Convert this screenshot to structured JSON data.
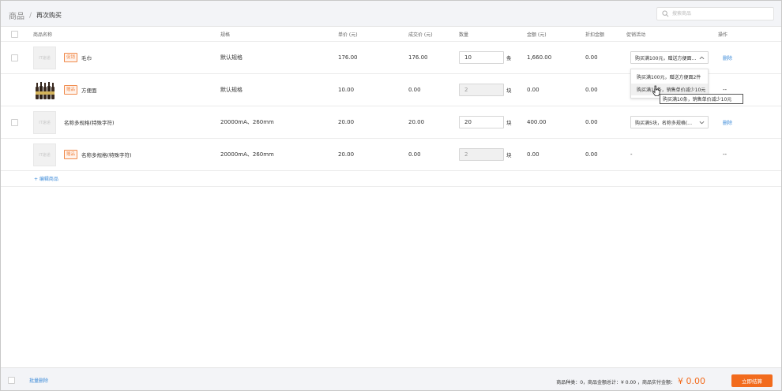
{
  "breadcrumb": {
    "root": "商品",
    "separator": "/",
    "current": "再次购买"
  },
  "search": {
    "placeholder": "搜索商品"
  },
  "table": {
    "columns": [
      "商品名称",
      "规格",
      "单价 (元)",
      "成交价 (元)",
      "数量",
      "金额 (元)",
      "折扣金额",
      "促销活动",
      "操作"
    ],
    "rows": [
      {
        "thumb": "IT速递",
        "tag": "促销",
        "name": "毛巾",
        "spec": "默认规格",
        "unit_price": "176.00",
        "deal_price": "176.00",
        "qty": "10",
        "unit": "条",
        "amount": "1,660.00",
        "discount": "0.00",
        "promo": "购买满100元，赠送方便面…",
        "action": "删除"
      },
      {
        "tag": "赠品",
        "name": "方便面",
        "spec": "默认规格",
        "unit_price": "10.00",
        "deal_price": "0.00",
        "qty": "2",
        "unit": "块",
        "amount": "0.00",
        "discount": "0.00",
        "promo": "",
        "action": "--"
      },
      {
        "thumb": "IT速递",
        "tag": "",
        "name": "名称多规格(特殊字符)",
        "spec": "20000mA、260mm",
        "unit_price": "20.00",
        "deal_price": "20.00",
        "qty": "20",
        "unit": "块",
        "amount": "400.00",
        "discount": "0.00",
        "promo": "购买满5块，名称多规格(…",
        "action": "删除"
      },
      {
        "thumb": "IT速递",
        "tag": "赠品",
        "name": "名称多规格(特殊字符)",
        "spec": "20000mA、260mm",
        "unit_price": "20.00",
        "deal_price": "0.00",
        "qty": "2",
        "unit": "块",
        "amount": "0.00",
        "discount": "0.00",
        "promo": "-",
        "action": "--"
      }
    ],
    "edit_link": "+ 编辑商品"
  },
  "promo_dropdown": {
    "options": [
      "购买满100元，赠送方便面2件",
      "购买满10条，销售单价减少10元"
    ],
    "tooltip": "购买满10条，销售单价减少10元"
  },
  "footer": {
    "batch_delete": "批量删除",
    "summary": "商品种类：0，商品金额总计：¥ 0.00 ，商品实付金额：",
    "total": "¥ 0.00",
    "settle_button": "立即结算"
  },
  "colors": {
    "accent": "#f26b1d",
    "link": "#3d8bd9",
    "tag": "#f08a4b"
  }
}
